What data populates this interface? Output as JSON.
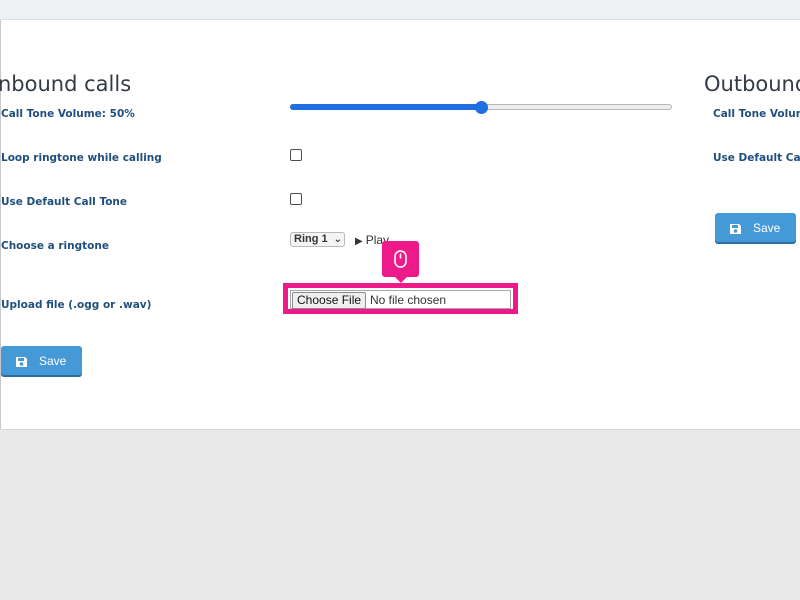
{
  "inbound": {
    "title": "nbound calls",
    "volume_label": "Call Tone Volume: 50%",
    "volume_value": 50,
    "loop_label": "Loop ringtone while calling",
    "loop_checked": false,
    "default_tone_label": "Use Default Call Tone",
    "default_tone_checked": false,
    "ringtone_label": "Choose a ringtone",
    "ringtone_selected": "Ring 1",
    "play_label": "Play",
    "upload_label": "Upload file (.ogg or .wav)",
    "choose_file_label": "Choose File",
    "file_status": "No file chosen",
    "save_label": "Save"
  },
  "outbound": {
    "title": "Outbound",
    "volume_label": "Call Tone Volume",
    "default_tone_label": "Use Default Call",
    "save_label": "Save"
  },
  "icons": {
    "save": "floppy-disk-icon",
    "play": "play-triangle-icon",
    "cursor": "mouse-icon",
    "dropdown": "chevron-down-icon"
  },
  "colors": {
    "accent": "#1f6fe3",
    "button": "#4699d7",
    "label": "#1f4f7d",
    "highlight": "#ee1a8a"
  }
}
